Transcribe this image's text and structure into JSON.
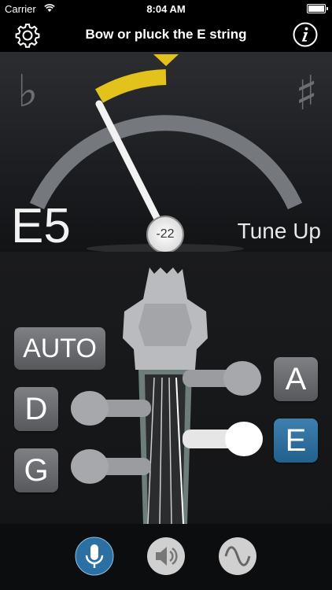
{
  "status_bar": {
    "carrier": "Carrier",
    "time": "8:04 AM"
  },
  "header": {
    "title": "Bow or pluck the E string"
  },
  "meter": {
    "flat_symbol": "♭",
    "sharp_symbol": "♯",
    "note": "E5",
    "cents": "-22",
    "hint": "Tune Up",
    "accent_color": "#e3c21b"
  },
  "buttons": {
    "auto": "AUTO",
    "d": "D",
    "g": "G",
    "a": "A",
    "e": "E",
    "selected": "E"
  },
  "bottom_bar": {
    "icons": [
      "microphone-icon",
      "speaker-icon",
      "sine-wave-icon"
    ],
    "active": "microphone"
  }
}
